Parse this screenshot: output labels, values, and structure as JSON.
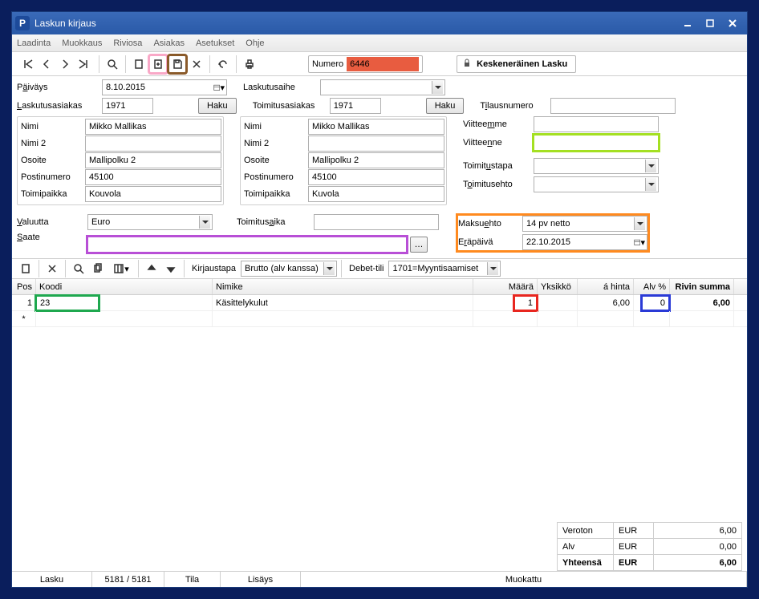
{
  "window": {
    "title": "Laskun kirjaus"
  },
  "menu": {
    "laadinta": "Laadinta",
    "muokkaus": "Muokkaus",
    "riviosa": "Riviosa",
    "asiakas": "Asiakas",
    "asetukset": "Asetukset",
    "ohje": "Ohje"
  },
  "numero": {
    "label": "Numero",
    "value": "6446"
  },
  "status_pill": "Keskeneräinen Lasku",
  "labels": {
    "paivays": "Päiväys",
    "laskutusaihe": "Laskutusaihe",
    "laskutusasiakas": "Laskutusasiakas",
    "toimitusasiakas": "Toimitusasiakas",
    "haku": "Haku",
    "nimi": "Nimi",
    "nimi2": "Nimi 2",
    "osoite": "Osoite",
    "postinumero": "Postinumero",
    "toimipaikka": "Toimipaikka",
    "tilausnumero": "Tilausnumero",
    "viitteemme": "Viitteemme",
    "viitteenne": "Viitteenne",
    "toimitustapa": "Toimitustapa",
    "toimitusehto": "Toimitusehto",
    "valuutta": "Valuutta",
    "toimitusaika": "Toimitusaika",
    "maksuehto": "Maksuehto",
    "erapaiva": "Eräpäivä",
    "saate": "Saate",
    "kirjaustapa": "Kirjaustapa",
    "debet_tili": "Debet-tili"
  },
  "values": {
    "paivays": "8.10.2015",
    "laskutusaihe": "",
    "laskutusasiakas_id": "1971",
    "toimitusasiakas_id": "1971",
    "bill": {
      "nimi": "Mikko Mallikas",
      "nimi2": "",
      "osoite": "Mallipolku 2",
      "postinumero": "45100",
      "toimipaikka": "Kouvola"
    },
    "ship": {
      "nimi": "Mikko Mallikas",
      "nimi2": "",
      "osoite": "Mallipolku 2",
      "postinumero": "45100",
      "toimipaikka": "Kuvola"
    },
    "tilausnumero": "",
    "viitteemme": "",
    "viitteenne": "",
    "toimitustapa": "",
    "toimitusehto": "",
    "valuutta": "Euro",
    "toimitusaika": "",
    "maksuehto": "14 pv netto",
    "erapaiva": "22.10.2015",
    "saate": "",
    "kirjaustapa": "Brutto (alv kanssa)",
    "debet_tili": "1701=Myyntisaamiset"
  },
  "grid": {
    "headers": {
      "pos": "Pos",
      "koodi": "Koodi",
      "nimike": "Nimike",
      "maara": "Määrä",
      "yksikko": "Yksikkö",
      "hinta": "á hinta",
      "alv": "Alv %",
      "summa": "Rivin summa"
    },
    "row1": {
      "pos": "1",
      "koodi": "23",
      "nimike": "Käsittelykulut",
      "maara": "1",
      "yksikko": "",
      "hinta": "6,00",
      "alv": "0",
      "summa": "6,00"
    },
    "new_marker": "*"
  },
  "totals": {
    "veroton_lbl": "Veroton",
    "veroton_cur": "EUR",
    "veroton_val": "6,00",
    "alv_lbl": "Alv",
    "alv_cur": "EUR",
    "alv_val": "0,00",
    "yht_lbl": "Yhteensä",
    "yht_cur": "EUR",
    "yht_val": "6,00"
  },
  "statusbar": {
    "lasku": "Lasku",
    "count": "5181 / 5181",
    "tila": "Tila",
    "lisays": "Lisäys",
    "muokattu": "Muokattu"
  }
}
